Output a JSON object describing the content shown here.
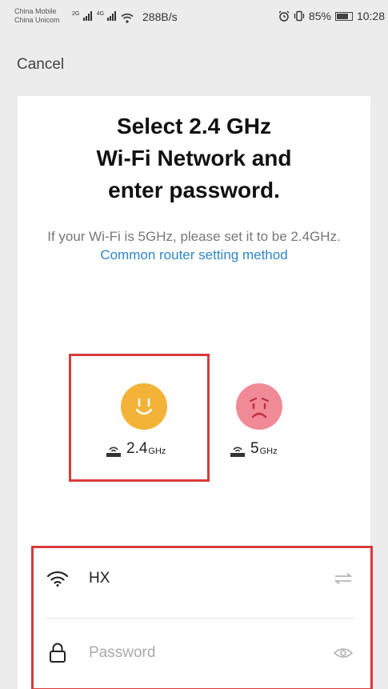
{
  "status_bar": {
    "carrier_1": "China Mobile",
    "carrier_2": "China Unicom",
    "network_tag_1": "2G",
    "network_tag_2": "4G",
    "speed": "288B/s",
    "battery": "85%",
    "time": "10:28"
  },
  "header": {
    "cancel_label": "Cancel"
  },
  "card": {
    "title_line_1": "Select 2.4 GHz",
    "title_line_2": "Wi-Fi Network and",
    "title_line_3": "enter password.",
    "subtitle_text": "If your Wi-Fi is 5GHz, please set it to be 2.4GHz.",
    "subtitle_link": "Common router setting method",
    "band_24": {
      "number": "2.4",
      "unit": "GHz",
      "face_color": "#f2b338"
    },
    "band_5": {
      "number": "5",
      "unit": "GHz",
      "face_color": "#f08a97"
    },
    "ssid_value": "HX",
    "password_placeholder": "Password"
  },
  "colors": {
    "link": "#2e86c9",
    "highlight": "#d93a3a"
  }
}
